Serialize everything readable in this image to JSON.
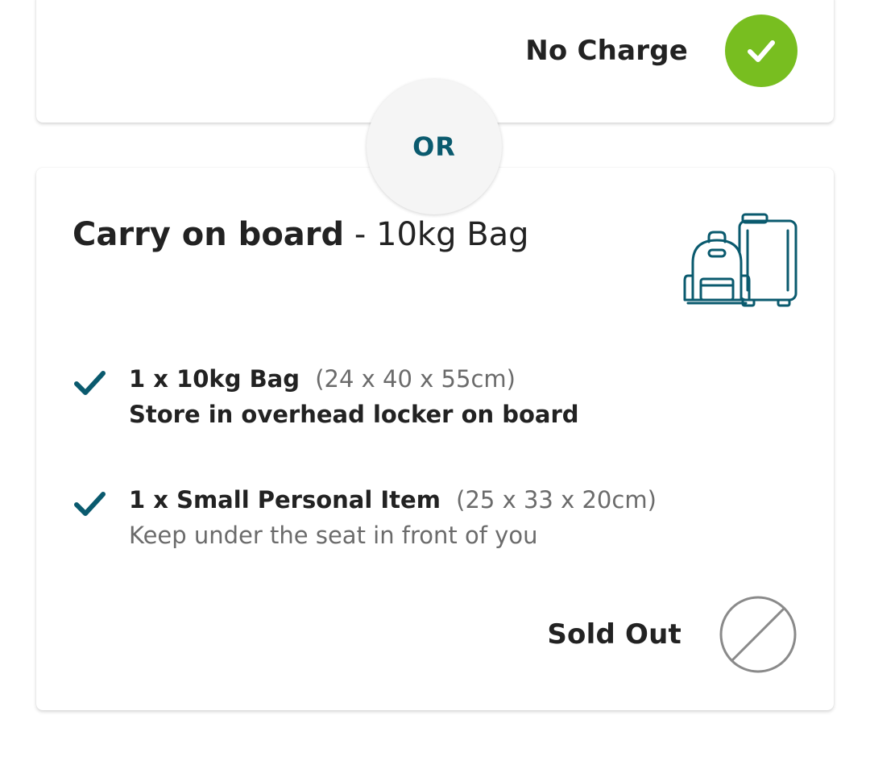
{
  "top_card": {
    "option_label": "No Charge",
    "option_icon": "check-icon",
    "option_color": "#78be20"
  },
  "divider": {
    "label": "OR",
    "color": "#0a5a6e"
  },
  "bottom_card": {
    "title_bold": "Carry on board",
    "title_separator": "-",
    "title_rest": "10kg Bag",
    "illustration_icon": "backpack-and-suitcase-icon",
    "accent_color": "#0a5a6e",
    "features": [
      {
        "icon": "check-icon",
        "name": "1 x 10kg Bag",
        "dimensions": "(24 x 40 x 55cm)",
        "description": "Store in overhead locker on board"
      },
      {
        "icon": "check-icon",
        "name": "1 x Small Personal Item",
        "dimensions": "(25 x 33 x 20cm)",
        "description": "Keep under the seat in front of you"
      }
    ],
    "option_label": "Sold Out",
    "option_icon": "unavailable-icon"
  }
}
